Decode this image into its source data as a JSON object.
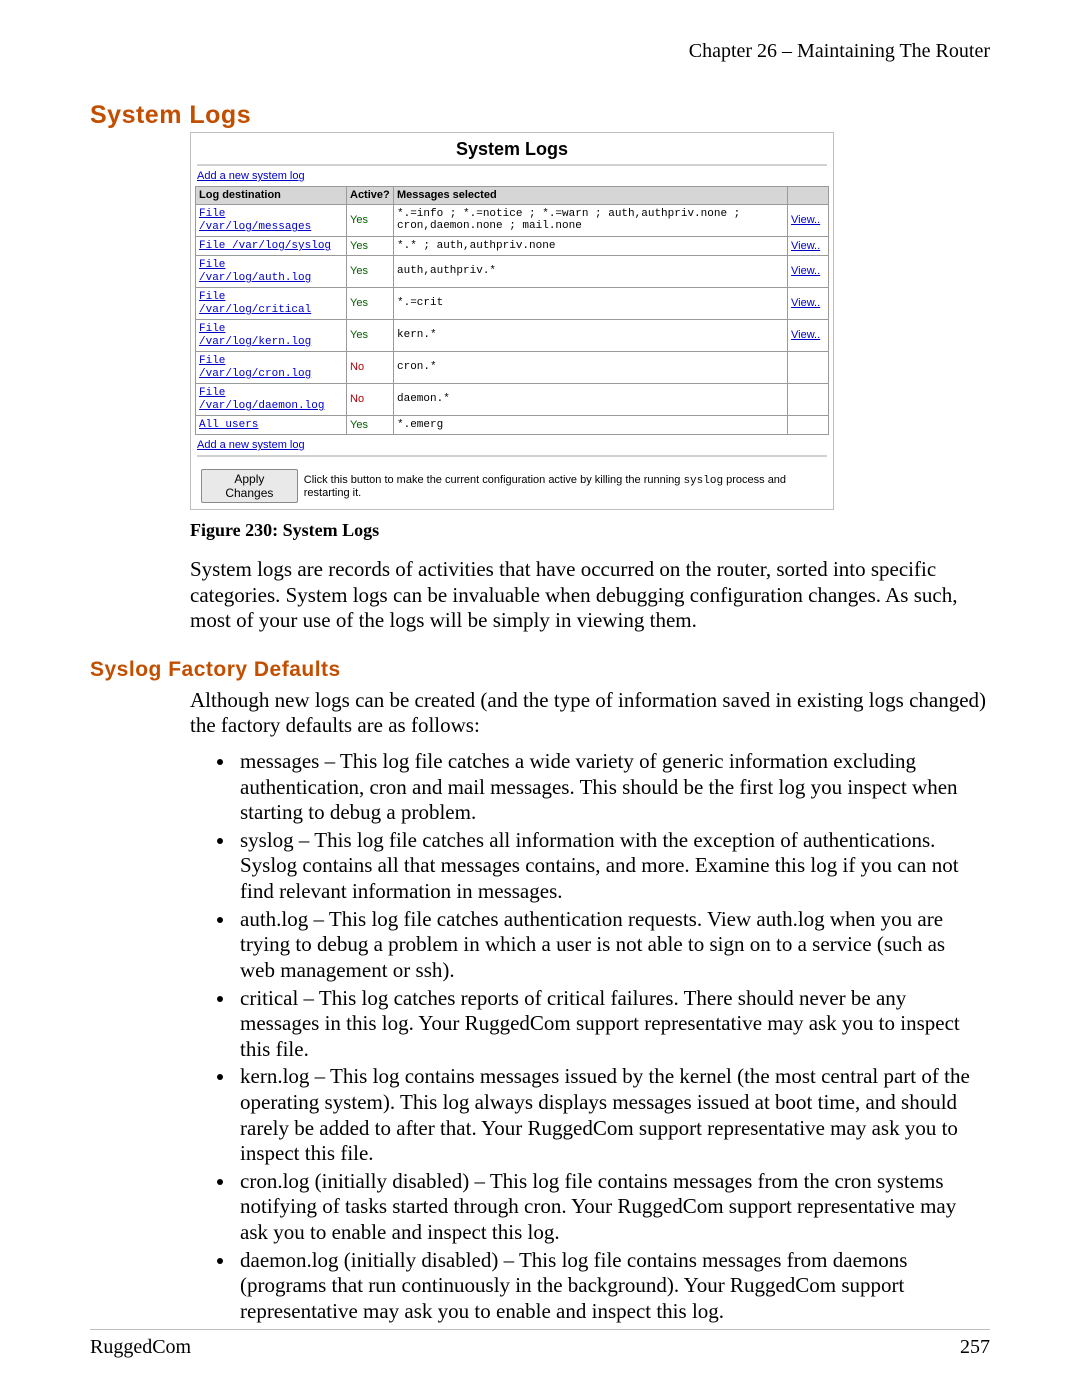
{
  "chapter": "Chapter 26 – Maintaining The Router",
  "headings": {
    "h1": "System Logs",
    "h2": "Syslog Factory Defaults"
  },
  "screenshot": {
    "title": "System Logs",
    "add_link_top": "Add a new system log",
    "add_link_bottom": "Add a new system log",
    "columns": {
      "dest": "Log destination",
      "active": "Active?",
      "msgs": "Messages selected",
      "view": ""
    },
    "rows": [
      {
        "dest_link": "File /var/log/messages",
        "active": "Yes",
        "cls": "yes",
        "msgs": "*.=info ; *.=notice ; *.=warn ; auth,authpriv.none ; cron,daemon.none ; mail.none",
        "view": "View.."
      },
      {
        "dest_link": "File /var/log/syslog",
        "active": "Yes",
        "cls": "yes",
        "msgs": "*.* ; auth,authpriv.none",
        "view": "View.."
      },
      {
        "dest_link": "File /var/log/auth.log",
        "active": "Yes",
        "cls": "yes",
        "msgs": "auth,authpriv.*",
        "view": "View.."
      },
      {
        "dest_link": "File /var/log/critical",
        "active": "Yes",
        "cls": "yes",
        "msgs": "*.=crit",
        "view": "View.."
      },
      {
        "dest_link": "File /var/log/kern.log",
        "active": "Yes",
        "cls": "yes",
        "msgs": "kern.*",
        "view": "View.."
      },
      {
        "dest_link": "File /var/log/cron.log",
        "active": "No",
        "cls": "no",
        "msgs": "cron.*",
        "view": ""
      },
      {
        "dest_link": "File /var/log/daemon.log",
        "active": "No",
        "cls": "no",
        "msgs": "daemon.*",
        "view": ""
      },
      {
        "dest_link": "All users",
        "active": "Yes",
        "cls": "yes",
        "msgs": "*.emerg",
        "view": ""
      }
    ],
    "apply_button": "Apply Changes",
    "apply_text_before": "Click this button to make the current configuration active by killing the running ",
    "apply_text_mono": "syslog",
    "apply_text_after": " process and restarting it."
  },
  "fig_caption": "Figure 230: System Logs",
  "para_a": "System logs are records of activities that have occurred on the router, sorted into specific categories.  System logs can be invaluable when debugging configuration changes.  As such, most of your use of the logs will be simply in viewing them.",
  "para_b": "Although new logs can be created (and the type of information saved in existing logs changed) the factory defaults are as follows:",
  "bullets": [
    "messages – This log file catches a wide variety of generic information excluding authentication, cron and mail messages.  This should be the first log you inspect when starting to debug a problem.",
    "syslog – This log file catches all information with the exception of authentications.  Syslog contains all that messages contains, and more.  Examine this log if you can not find relevant information in messages.",
    "auth.log – This log file catches authentication requests.  View auth.log when you are trying to debug a problem in which a user is not able to sign on to a service (such as web management or ssh).",
    "critical – This log catches reports of critical failures.  There should never be any messages in this log.  Your RuggedCom support representative may ask you to inspect this file.",
    "kern.log – This log contains messages issued by the kernel (the most central part of the operating system).  This log always displays messages issued at boot time, and should rarely be added to after that.  Your RuggedCom support representative may ask you to inspect this file.",
    "cron.log (initially disabled) – This log file contains messages from the cron systems notifying of tasks started through cron.  Your RuggedCom support representative may ask you to enable and inspect this log.",
    "daemon.log (initially disabled) – This log file contains messages from daemons (programs that run continuously in the background).   Your RuggedCom support representative may ask you to enable and inspect this log."
  ],
  "footer": {
    "left": "RuggedCom",
    "right": "257"
  }
}
